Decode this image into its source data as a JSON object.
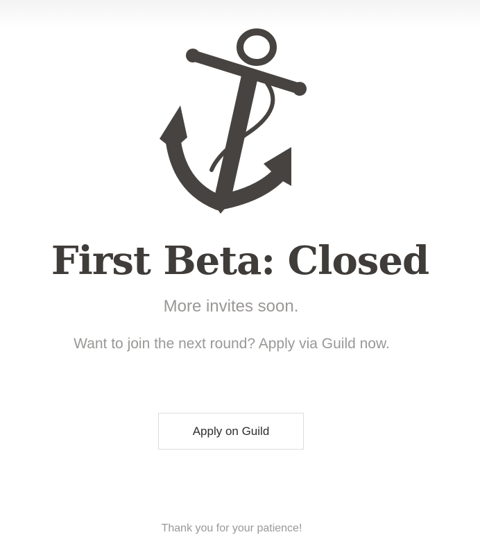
{
  "logo": {
    "icon": "anchor-icon",
    "color": "#474340"
  },
  "heading": {
    "title": "First Beta: Closed"
  },
  "message": {
    "subtitle": "More invites soon.",
    "body": "Want to join the next round? Apply via Guild now."
  },
  "cta": {
    "label": "Apply on Guild"
  },
  "footer": {
    "text": "Thank you for your patience!"
  },
  "colors": {
    "title": "#3f3c39",
    "muted_text": "#9a9896",
    "button_border": "#dcdcdc"
  }
}
